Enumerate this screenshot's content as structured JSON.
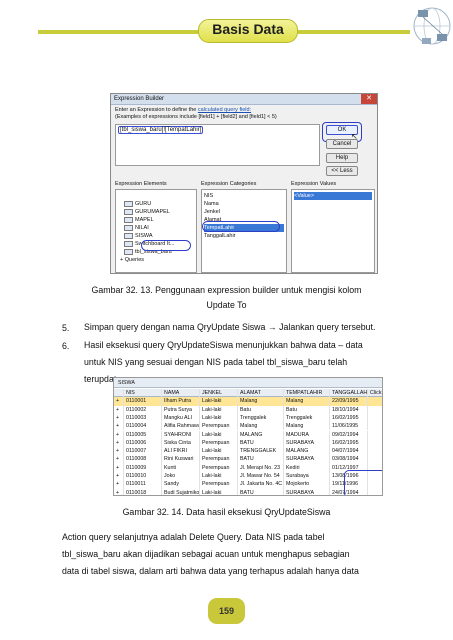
{
  "header": {
    "title": "Basis Data"
  },
  "figure1": {
    "window_title": "Expression Builder",
    "instruction_prefix": "Enter an Expression to define the ",
    "instruction_link": "calculated query field:",
    "instruction_line2": "(Examples of expressions include [field1] + [field2] and [field1] < 5)",
    "expression": "[tbl_siswa_baru]![TempatLahir]",
    "buttons": {
      "ok": "OK",
      "cancel": "Cancel",
      "help": "Help",
      "less": "<< Less"
    },
    "col_elements": "Expression Elements",
    "col_categories": "Expression Categories",
    "col_values": "Expression Values",
    "elements": [
      "GURU",
      "GURUMAPEL",
      "MAPEL",
      "NILAI",
      "SISWA",
      "Switchboard It...",
      "tbl_siswa_baru",
      "Queries"
    ],
    "categories": [
      "NIS",
      "Nama",
      "Jenkel",
      "Alamat",
      "TempatLahir",
      "TanggalLahir"
    ],
    "values": [
      "<Value>"
    ],
    "caption_line1": "Gambar 32. 13. Penggunaan expression builder untuk mengisi kolom",
    "caption_line2": "Update To"
  },
  "steps": [
    {
      "num": "5.",
      "text": "Simpan query dengan nama QryUpdate Siswa → Jalankan query tersebut."
    },
    {
      "num": "6.",
      "lines": [
        "Hasil eksekusi query QryUpdateSiswa menunjukkan bahwa data – data",
        "untuk NIS yang sesuai dengan NIS pada tabel tbl_siswa_baru telah",
        "terupdate."
      ]
    }
  ],
  "figure2": {
    "tab": "SISWA",
    "headers": [
      "NIS",
      "NAMA",
      "JENKEL",
      "ALAMAT",
      "TEMPATLAHIR",
      "TANGGALLAH",
      "Click to Add"
    ],
    "rows": [
      [
        "0110001",
        "Ilham Putra",
        "Laki-laki",
        "Malang",
        "Malang",
        "22/09/1995"
      ],
      [
        "0110002",
        "Putra Surya",
        "Laki-laki",
        "Batu",
        "Batu",
        "18/10/1994"
      ],
      [
        "0110003",
        "Mangku ALI",
        "Laki-laki",
        "Trenggalek",
        "Trenggalek",
        "16/02/1995"
      ],
      [
        "0110004",
        "Alifia Rahmawati",
        "Perempuan",
        "Malang",
        "Malang",
        "11/06/1995"
      ],
      [
        "0110005",
        "SYAHRONI",
        "Laki-laki",
        "MALANG",
        "MADURA",
        "09/02/1994"
      ],
      [
        "0110006",
        "Siska Cinta",
        "Perempuan",
        "BATU",
        "SURABAYA",
        "16/02/1995"
      ],
      [
        "0110007",
        "ALI FIKRI",
        "Laki-laki",
        "TRENGGALEK",
        "MALANG",
        "04/07/1994"
      ],
      [
        "0110008",
        "Rini Kuswari",
        "Perempuan",
        "BATU",
        "SURABAYA",
        "03/08/1994"
      ],
      [
        "0110009",
        "Kunti",
        "Perempuan",
        "Jl. Merapi No. 23",
        "Kediri",
        "01/12/1997"
      ],
      [
        "0110010",
        "Joko",
        "Laki-laki",
        "Jl. Mawar No. 54",
        "Surabaya",
        "13/08/1996"
      ],
      [
        "0110011",
        "Sandy",
        "Perempuan",
        "Jl. Jakarta No. 4C",
        "Mojokerto",
        "19/11/1996"
      ],
      [
        "0110018",
        "Budi Sujatmiko",
        "Laki-laki",
        "BATU",
        "SURABAYA",
        "24/07/1994"
      ]
    ],
    "caption": "Gambar 32. 14. Data hasil eksekusi QryUpdateSiswa"
  },
  "closing": [
    "Action query selanjutnya adalah Delete Query. Data NIS pada tabel",
    "tbl_siswa_baru akan dijadikan sebagai acuan untuk menghapus sebagian",
    "data di tabel siswa, dalam arti bahwa data yang terhapus adalah  hanya data"
  ],
  "page_number": "159"
}
